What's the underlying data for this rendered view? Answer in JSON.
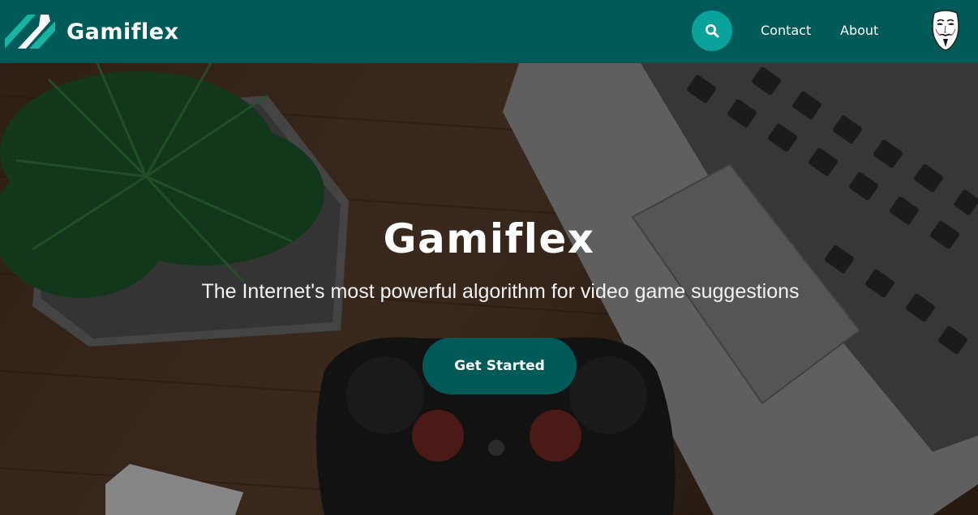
{
  "navbar": {
    "brand": "Gamiflex",
    "search_icon": "search-icon",
    "links": [
      {
        "label": "Contact"
      },
      {
        "label": "About"
      }
    ],
    "avatar_icon": "anonymous-mask-icon"
  },
  "hero": {
    "title": "Gamiflex",
    "subtitle": "The Internet's most powerful algorithm for video game suggestions",
    "cta_label": "Get Started",
    "background": "desk-with-plant-laptop-controller-phone"
  },
  "colors": {
    "navbar_bg": "#005a58",
    "search_button": "#0aa39b",
    "cta_bg": "#005a58",
    "logo_accent": "#17b3a3"
  }
}
